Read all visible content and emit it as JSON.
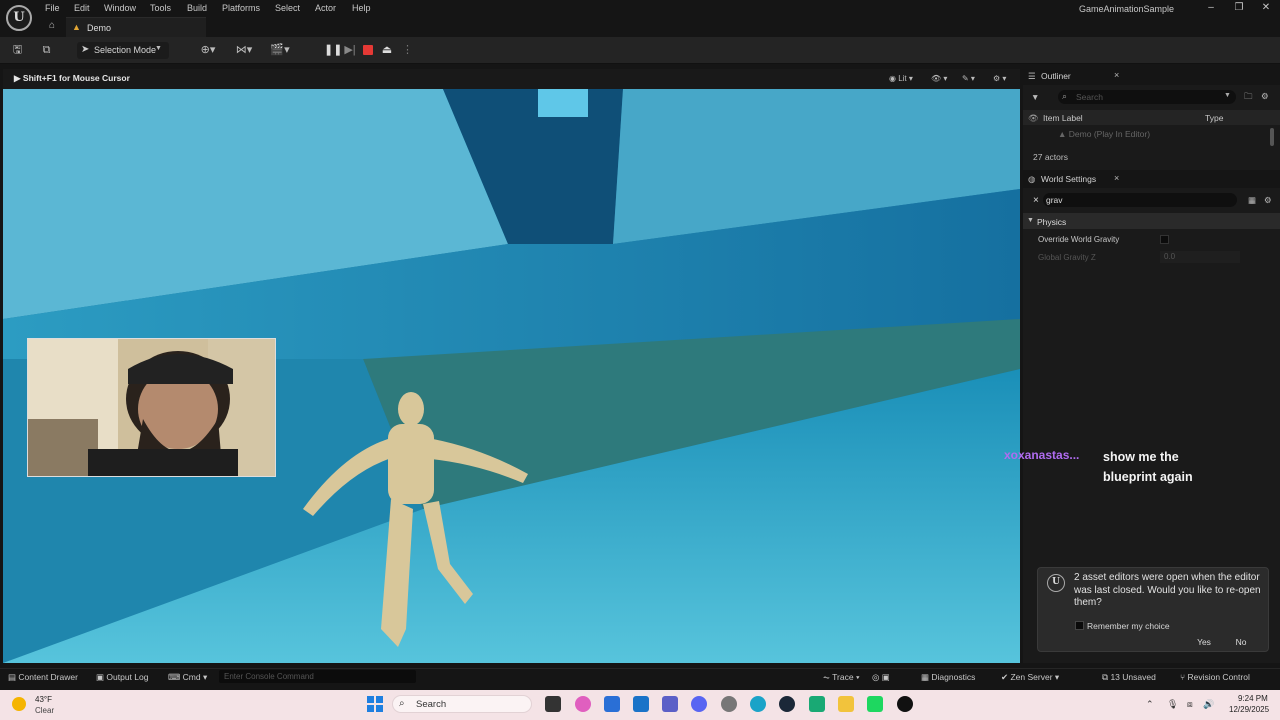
{
  "menubar": {
    "items": [
      "File",
      "Edit",
      "Window",
      "Tools",
      "Build",
      "Platforms",
      "Select",
      "Actor",
      "Help"
    ],
    "app_title": "GameAnimationSample"
  },
  "tabs": {
    "level_tab": "Demo"
  },
  "toolbar": {
    "selection_mode": "Selection Mode"
  },
  "viewport": {
    "hint": "Shift+F1 for Mouse Cursor",
    "view_mode": "Lit"
  },
  "outliner": {
    "title": "Outliner",
    "search_placeholder": "Search",
    "col_label": "Item Label",
    "col_type": "Type",
    "row_demo": "Demo (Play In Editor)",
    "actor_count": "27 actors"
  },
  "world_settings": {
    "title": "World Settings",
    "search_value": "grav",
    "category": "Physics",
    "prop_override": "Override World Gravity",
    "prop_global": "Global Gravity Z",
    "global_value": "0.0"
  },
  "toast": {
    "message": "2 asset editors were open when the editor was last closed. Would you like to re-open them?",
    "remember": "Remember my choice",
    "yes": "Yes",
    "no": "No"
  },
  "chat": {
    "username": "xoxanastas...",
    "message": "show me the blueprint again"
  },
  "statusbar": {
    "content_drawer": "Content Drawer",
    "output_log": "Output Log",
    "cmd": "Cmd",
    "console_placeholder": "Enter Console Command",
    "trace": "Trace",
    "diagnostics": "Diagnostics",
    "zen_server": "Zen Server",
    "unsaved": "13 Unsaved",
    "revision_control": "Revision Control"
  },
  "taskbar": {
    "temperature": "43°F",
    "weather": "Clear",
    "search": "Search",
    "time": "9:24 PM",
    "date": "12/29/2025"
  },
  "colors": {
    "accent_orange": "#e2a634",
    "chat_name": "#b06cf0",
    "stop_red": "#e53935",
    "viewport_blue": "#1b6f92"
  }
}
